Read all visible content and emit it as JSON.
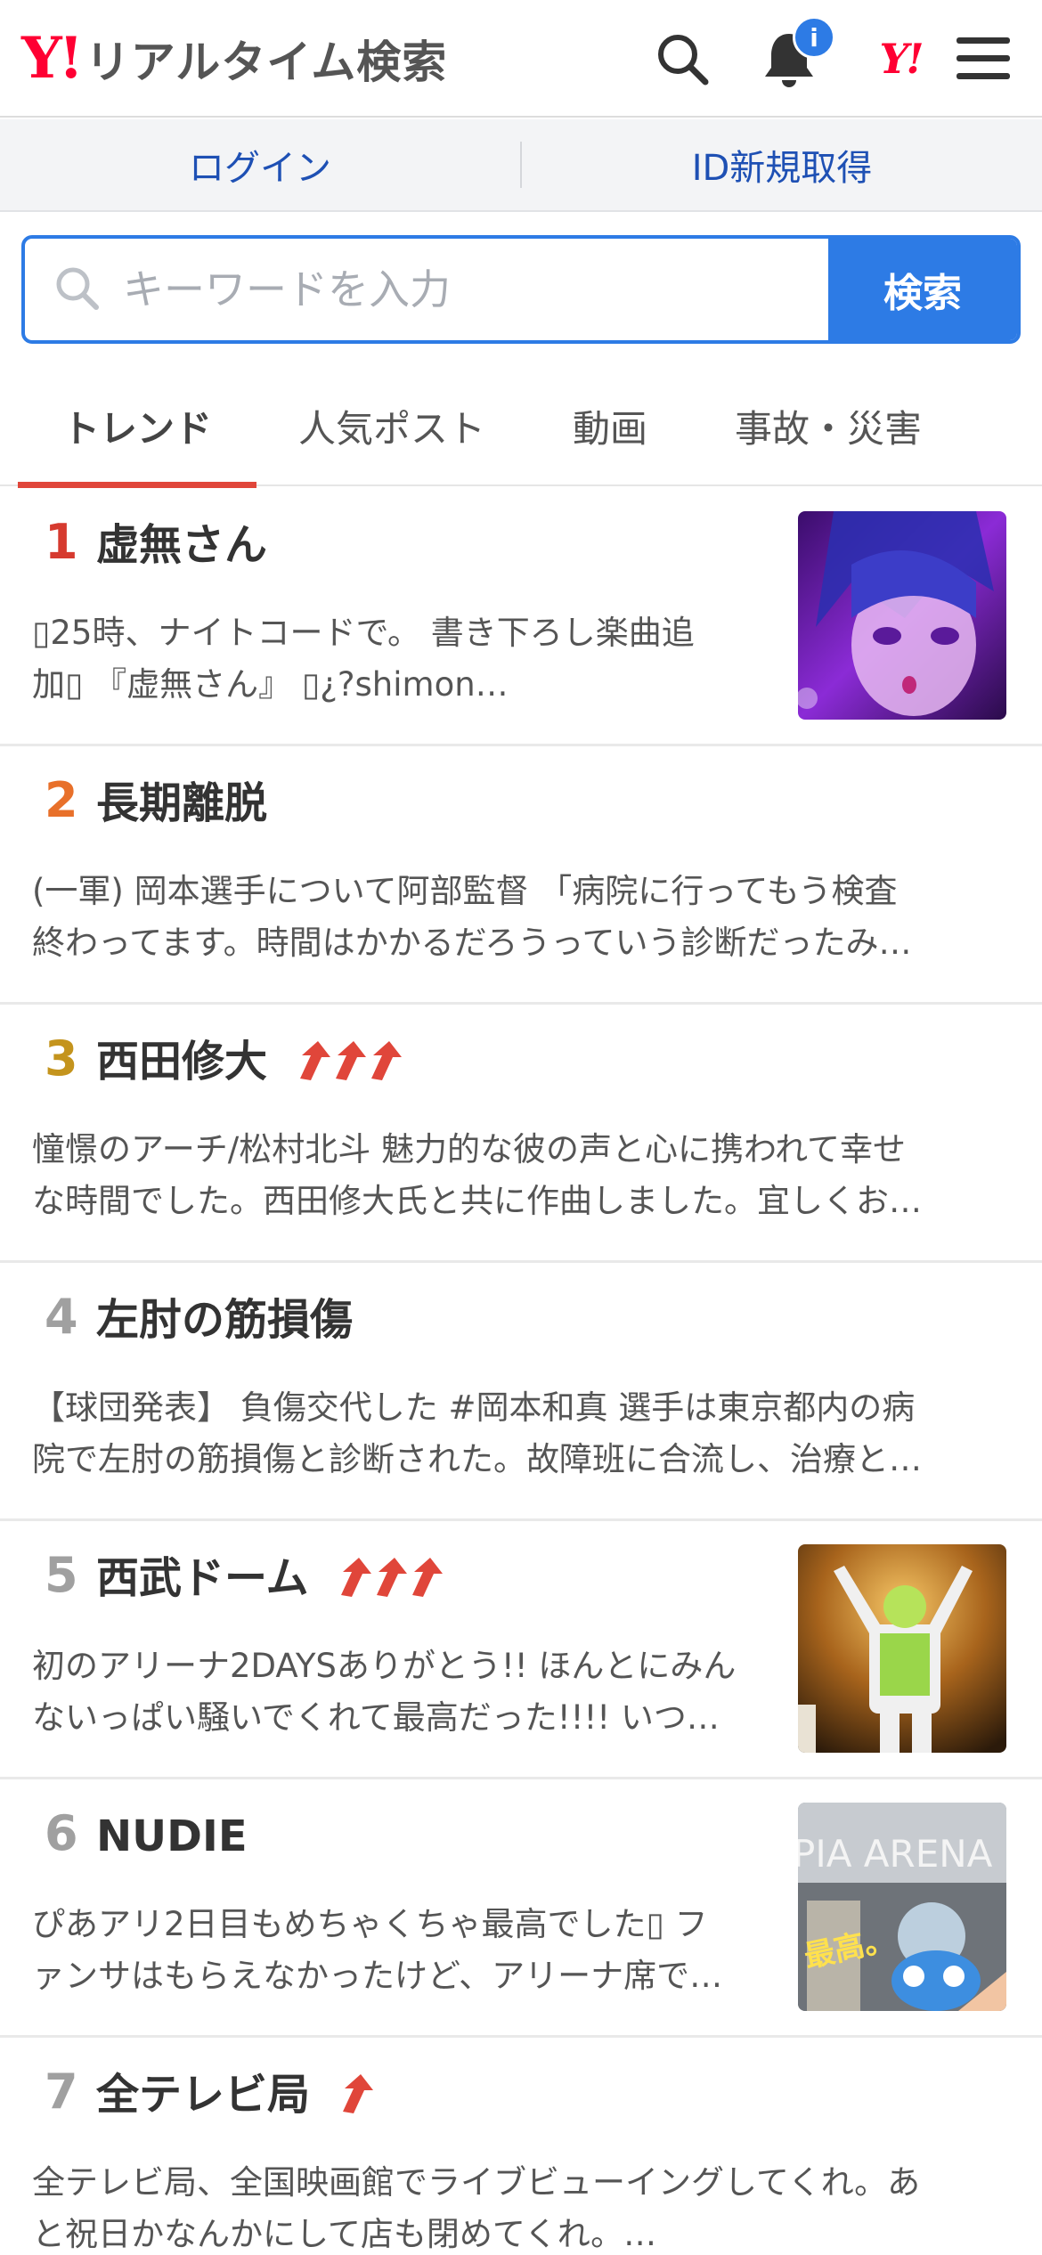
{
  "header": {
    "logo_mark": "Y!",
    "logo_text": "リアルタイム検索",
    "notification_badge": "i",
    "yahoo_mark": "Y!",
    "icons": [
      "search-icon",
      "bell-icon",
      "yahoo-logo-icon",
      "menu-icon"
    ]
  },
  "login_bar": {
    "login": "ログイン",
    "register": "ID新規取得"
  },
  "search": {
    "placeholder": "キーワードを入力",
    "button": "検索"
  },
  "tabs": [
    {
      "label": "トレンド",
      "active": true
    },
    {
      "label": "人気ポスト",
      "active": false
    },
    {
      "label": "動画",
      "active": false
    },
    {
      "label": "事故・災害",
      "active": false
    }
  ],
  "colors": {
    "brand_red": "#ff0033",
    "accent_blue": "#2d7be5",
    "tab_underline": "#e0463a",
    "rank1": "#d63a2f",
    "rank2": "#e8702a",
    "rank3": "#c4941d",
    "rank_other": "#a0a0a0"
  },
  "trends": [
    {
      "rank": "1",
      "title": "虚無さん",
      "arrows": 0,
      "has_thumb": true,
      "line1": "▯25時、ナイトコードで。 書き下ろし楽曲追",
      "line2": "加▯ 『虚無さん』 ▯¿?shimon…"
    },
    {
      "rank": "2",
      "title": "長期離脱",
      "arrows": 0,
      "has_thumb": false,
      "line1": "(一軍) 岡本選手について阿部監督 「病院に行ってもう検査",
      "line2": "終わってます。時間はかかるだろうっていう診断だったみ…"
    },
    {
      "rank": "3",
      "title": "西田修大",
      "arrows": 3,
      "has_thumb": false,
      "line1": "憧憬のアーチ/松村北斗 魅力的な彼の声と心に携われて幸せ",
      "line2": "な時間でした。西田修大氏と共に作曲しました。宜しくお…"
    },
    {
      "rank": "4",
      "title": "左肘の筋損傷",
      "arrows": 0,
      "has_thumb": false,
      "line1": "【球団発表】 負傷交代した #岡本和真 選手は東京都内の病",
      "line2": "院で左肘の筋損傷と診断された。故障班に合流し、治療と…"
    },
    {
      "rank": "5",
      "title": "西武ドーム",
      "arrows": 3,
      "has_thumb": true,
      "line1": "初のアリーナ2DAYSありがとう!! ほんとにみん",
      "line2": "ないっぱい騒いでくれて最高だった!!!! いつ…"
    },
    {
      "rank": "6",
      "title": "NUDIE",
      "arrows": 0,
      "has_thumb": true,
      "line1": "ぴあアリ2日目もめちゃくちゃ最高でした▯ フ",
      "line2": "ァンサはもらえなかったけど、アリーナ席で…"
    },
    {
      "rank": "7",
      "title": "全テレビ局",
      "arrows": 1,
      "has_thumb": false,
      "line1": "全テレビ局、全国映画館でライブビューイングしてくれ。あ",
      "line2": "と祝日かなんかにして店も閉めてくれ。…"
    }
  ],
  "thumb_texts": {
    "thumb6": "PIA ARENA",
    "thumb6_handwritten": "最高。"
  }
}
